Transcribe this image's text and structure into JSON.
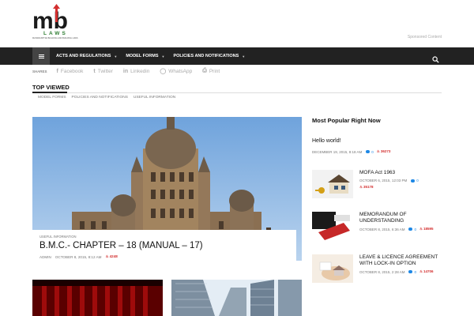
{
  "header": {
    "logo_mark": "mb",
    "logo_word": "LAWS",
    "logo_tagline": "MAHARASHTRA BUILDING AND BUILDING LAWS",
    "sponsored": "Sponsored Content"
  },
  "nav": {
    "items": [
      {
        "label": "ACTS AND REGULATIONS"
      },
      {
        "label": "MODEL FORMS"
      },
      {
        "label": "POLICIES AND NOTIFICATIONS"
      }
    ],
    "menu_icon": "hamburger-icon",
    "search_icon": "search-icon"
  },
  "share": {
    "label": "SHARES",
    "links": [
      {
        "label": "Facebook",
        "icon": "facebook-icon",
        "glyph": "f"
      },
      {
        "label": "Twitter",
        "icon": "twitter-icon",
        "glyph": "t"
      },
      {
        "label": "Linkedin",
        "icon": "linkedin-icon",
        "glyph": "in"
      },
      {
        "label": "WhatsApp",
        "icon": "whatsapp-icon",
        "glyph": "◯"
      },
      {
        "label": "Print",
        "icon": "print-icon",
        "glyph": "⎙"
      }
    ]
  },
  "top_viewed": {
    "title": "TOP VIEWED",
    "tabs": [
      {
        "label": "MODEL FORMS"
      },
      {
        "label": "POLICIES AND NOTIFICATIONS"
      },
      {
        "label": "USEFUL INFORMATION"
      }
    ]
  },
  "featured": {
    "category": "USEFUL INFORMATION",
    "title": "B.M.C.- CHAPTER – 18 (MANUAL – 17)",
    "author": "ADMIN",
    "date": "OCTOBER 8, 2015, 8:12 AM",
    "views": "4248"
  },
  "sidebar": {
    "title": "Most Popular Right Now",
    "first": {
      "title": "Hello world!",
      "date": "DECEMBER 19, 2015, 8:18 AM",
      "comments": "0",
      "views": "36273"
    },
    "items": [
      {
        "title": "MOFA Act 1963",
        "date": "OCTOBER 6, 2015, 12:03 PM",
        "comments": "0",
        "views": "35178"
      },
      {
        "title": "MEMORANDUM OF UNDERSTANDING",
        "date": "OCTOBER 8, 2015, 6:36 AM",
        "comments": "0",
        "views": "18595"
      },
      {
        "title": "LEAVE & LICENCE AGREEMENT WITH LOCK-IN OPTION",
        "date": "OCTOBER 8, 2015, 2:28 AM",
        "comments": "0",
        "views": "14706"
      }
    ]
  },
  "colors": {
    "nav_bg": "#222222",
    "accent_red": "#d32f2f",
    "accent_blue": "#1e88e5",
    "logo_green": "#2e7d32"
  }
}
